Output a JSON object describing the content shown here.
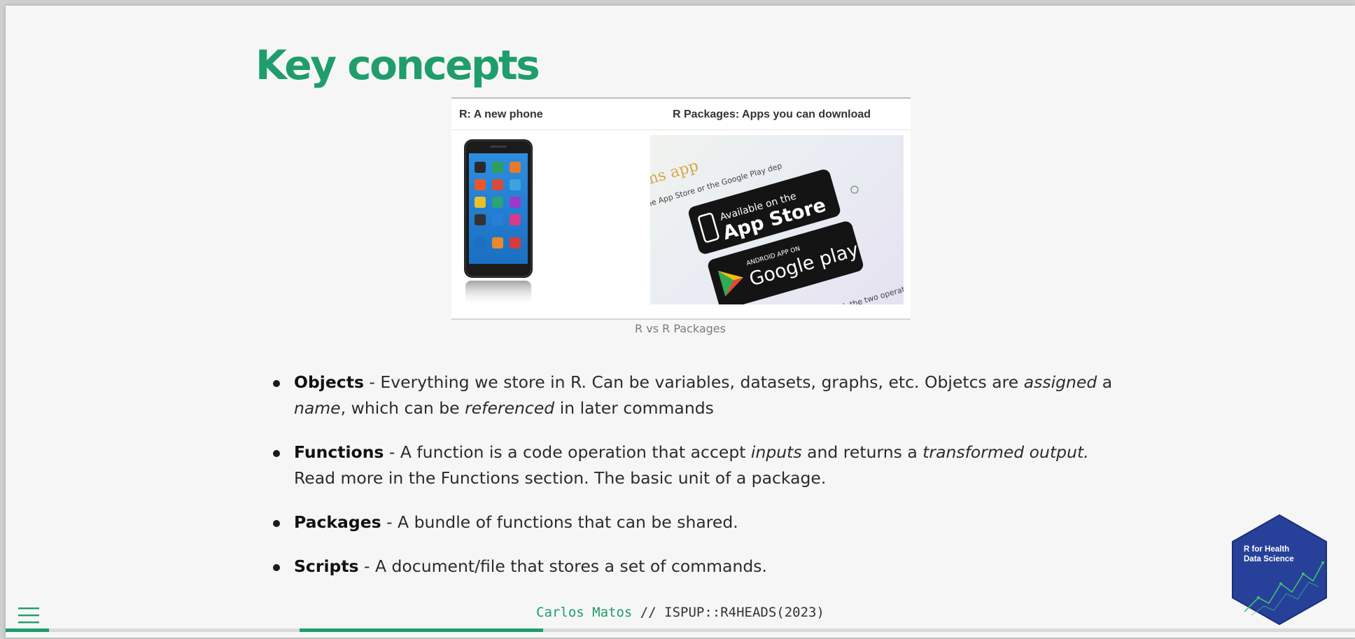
{
  "slide": {
    "title": "Key concepts",
    "figure": {
      "header_left": "R: A new phone",
      "header_right": "R Packages: Apps you can download",
      "caption": "R vs R Packages",
      "store_image": {
        "top_text": "orms app",
        "line_text": "a the App Store or the Google Play dep",
        "apple_small": "Available on the",
        "apple_big": "App Store",
        "google_small": "ANDROID APP ON",
        "google_big": "Google play",
        "bottom_text": "ndroid, the two operating"
      }
    },
    "bullets": [
      {
        "term": "Objects",
        "parts": [
          " - Everything we store in R. Can be variables, datasets, graphs, etc. Objetcs are ",
          "assigned",
          " a ",
          "name",
          ", which can be ",
          "referenced",
          " in later commands"
        ]
      },
      {
        "term": "Functions",
        "parts": [
          " - A function is a code operation that accept ",
          "inputs",
          " and returns a ",
          "transformed output.",
          " Read more in the Functions section. The basic unit of a package."
        ]
      },
      {
        "term": "Packages",
        "parts": [
          " - A bundle of functions that can be shared."
        ]
      },
      {
        "term": "Scripts",
        "parts": [
          " - A document/file that stores a set of commands."
        ]
      }
    ]
  },
  "footer": {
    "author": "Carlos Matos",
    "separator": " // ",
    "course": "ISPUP::R4HEADS(2023)"
  },
  "logo": {
    "line1": "R for Health",
    "line2": "Data Science",
    "fill_color": "#27419a",
    "line_color": "#3ec46d"
  },
  "menu": {
    "icon": "hamburger-menu-icon"
  },
  "colors": {
    "accent": "#1f9d6b",
    "slide_bg": "#f6f6f6"
  }
}
